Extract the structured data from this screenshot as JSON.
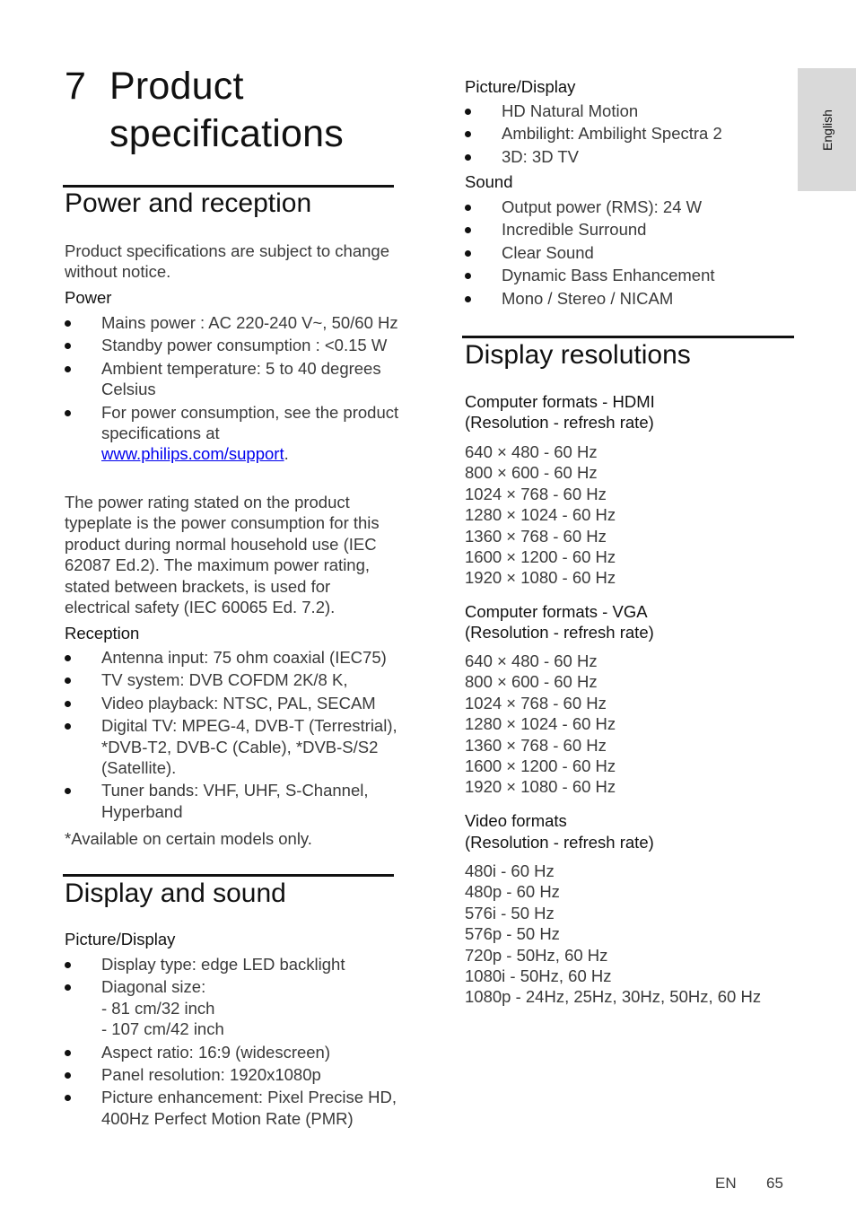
{
  "language_tab": "English",
  "chapter": {
    "number": "7",
    "title": "Product specifications"
  },
  "power_reception": {
    "heading": "Power and reception",
    "intro": "Product specifications are subject to change without notice.",
    "power": {
      "heading": "Power",
      "items": [
        "Mains power : AC 220-240 V~, 50/60 Hz",
        "Standby power consumption : <0.15 W",
        "Ambient temperature: 5 to 40 degrees Celsius"
      ],
      "last_item_text": "For power consumption, see the product specifications at ",
      "last_item_link": "www.philips.com/support",
      "last_item_suffix": "."
    },
    "rating_note": "The power rating stated on the product typeplate is the power consumption for this product during normal household use (IEC 62087 Ed.2). The maximum power rating, stated between brackets, is used for electrical safety (IEC 60065 Ed. 7.2).",
    "reception": {
      "heading": "Reception",
      "items": [
        "Antenna input: 75 ohm coaxial (IEC75)",
        "TV system: DVB COFDM 2K/8 K,",
        "Video playback: NTSC, PAL, SECAM",
        "Digital TV: MPEG-4, DVB-T (Terrestrial), *DVB-T2, DVB-C (Cable), *DVB-S/S2 (Satellite).",
        "Tuner bands: VHF, UHF, S-Channel, Hyperband"
      ]
    },
    "footnote": "*Available on certain models only."
  },
  "display_sound": {
    "heading": "Display and sound",
    "picture_heading": "Picture/Display",
    "picture_items": [
      "Display type: edge LED backlight",
      "Diagonal size:",
      "Aspect ratio: 16:9 (widescreen)",
      "Panel resolution: 1920x1080p",
      "Picture enhancement: Pixel Precise HD, 400Hz Perfect Motion Rate (PMR)"
    ],
    "diagonal_sizes": [
      "- 81 cm/32 inch",
      "- 107 cm/42 inch"
    ],
    "picture_cont_heading": "Picture/Display",
    "picture_cont_items": [
      "HD Natural Motion",
      "Ambilight: Ambilight Spectra 2",
      "3D: 3D TV"
    ],
    "sound_heading": "Sound",
    "sound_items": [
      "Output power (RMS): 24 W",
      "Incredible Surround",
      "Clear Sound",
      "Dynamic Bass Enhancement",
      "Mono / Stereo / NICAM"
    ]
  },
  "display_resolutions": {
    "heading": "Display resolutions",
    "hdmi": {
      "heading_line1": "Computer formats - HDMI",
      "heading_line2": "(Resolution - refresh rate)",
      "rows": [
        "640 × 480 - 60 Hz",
        "800 × 600 - 60 Hz",
        "1024 × 768 - 60 Hz",
        "1280 × 1024 - 60 Hz",
        "1360 × 768 - 60 Hz",
        "1600 × 1200 - 60 Hz",
        "1920 × 1080 - 60 Hz"
      ]
    },
    "vga": {
      "heading_line1": "Computer formats - VGA",
      "heading_line2": "(Resolution - refresh rate)",
      "rows": [
        "640 × 480 - 60 Hz",
        "800 × 600 - 60 Hz",
        "1024 × 768 - 60 Hz",
        "1280 × 1024 - 60 Hz",
        "1360 × 768 - 60 Hz",
        "1600 × 1200 - 60 Hz",
        "1920 × 1080 - 60 Hz"
      ]
    },
    "video": {
      "heading_line1": "Video formats",
      "heading_line2": "(Resolution - refresh rate)",
      "rows": [
        "480i - 60 Hz",
        "480p - 60 Hz",
        "576i - 50 Hz",
        "576p - 50 Hz",
        "720p - 50Hz, 60 Hz",
        "1080i - 50Hz, 60 Hz",
        "1080p - 24Hz, 25Hz, 30Hz, 50Hz, 60 Hz"
      ]
    }
  },
  "footer": {
    "lang": "EN",
    "page": "65"
  }
}
